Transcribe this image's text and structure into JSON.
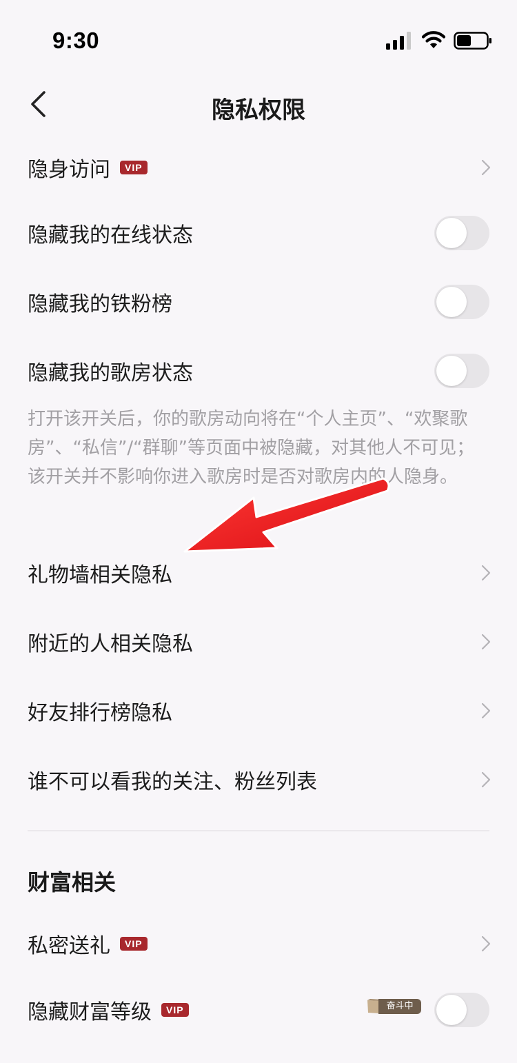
{
  "status_bar": {
    "time": "9:30"
  },
  "header": {
    "title": "隐私权限"
  },
  "rows": {
    "invisible_visit": {
      "label": "隐身访问",
      "badge": "VIP"
    },
    "hide_online_status": {
      "label": "隐藏我的在线状态",
      "toggle_on": false
    },
    "hide_fan_rank": {
      "label": "隐藏我的铁粉榜",
      "toggle_on": false
    },
    "hide_room_status": {
      "label": "隐藏我的歌房状态",
      "toggle_on": false
    },
    "gift_wall_privacy": {
      "label": "礼物墙相关隐私"
    },
    "nearby_privacy": {
      "label": "附近的人相关隐私"
    },
    "friend_rank_privacy": {
      "label": "好友排行榜隐私"
    },
    "follow_list_privacy": {
      "label": "谁不可以看我的关注、粉丝列表"
    },
    "private_gift": {
      "label": "私密送礼",
      "badge": "VIP"
    },
    "hide_wealth_level": {
      "label": "隐藏财富等级",
      "badge": "VIP",
      "tag": "奋斗中",
      "toggle_on": false
    }
  },
  "room_status_description": "打开该开关后，你的歌房动向将在“个人主页”、“欢聚歌房”、“私信”/“群聊”等页面中被隐藏，对其他人不可见；该开关并不影响你进入歌房时是否对歌房内的人隐身。",
  "section": {
    "wealth_title": "财富相关"
  },
  "colors": {
    "background": "#f8f6f9",
    "vip_badge": "#a8282d",
    "toggle_off": "#e7e5e8",
    "annotation_arrow": "#e8161c"
  }
}
